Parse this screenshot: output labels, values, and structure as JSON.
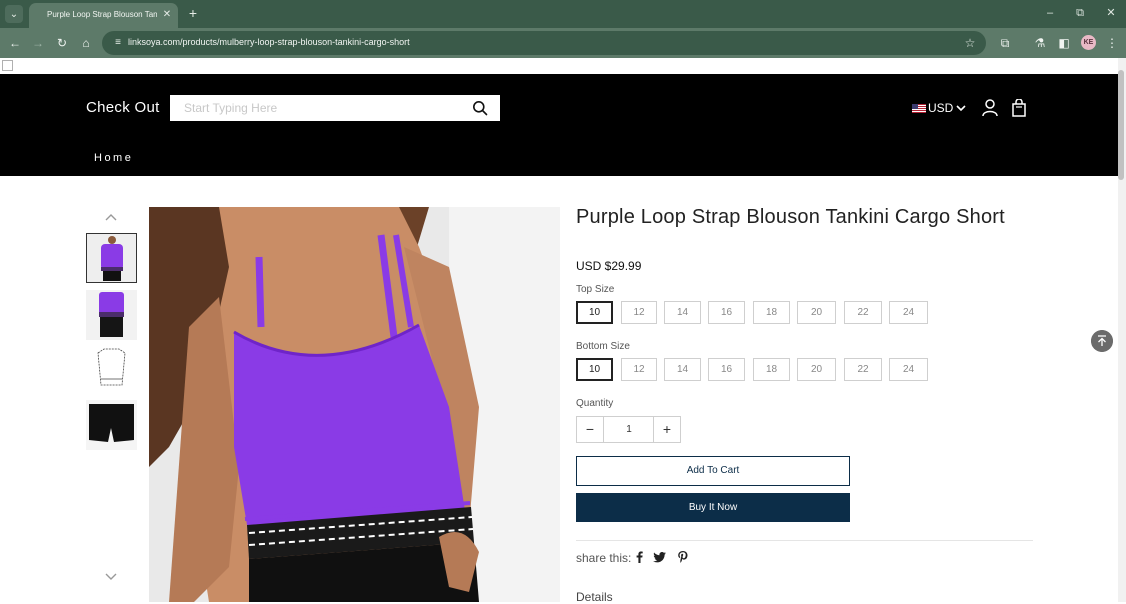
{
  "browser": {
    "tab_title": "Purple Loop Strap Blouson Tankini Cargo Short",
    "url": "linksoya.com/products/mulberry-loop-strap-blouson-tankini-cargo-short",
    "profile_initials": "KE",
    "chrome_color": "#5d7a69",
    "icons": [
      "tab-list-icon",
      "close-icon",
      "new-tab-icon",
      "minimize-icon",
      "restore-icon",
      "close-window-icon",
      "back-icon",
      "forward-icon",
      "reload-icon",
      "home-icon",
      "site-info-icon",
      "star-icon",
      "extensions-icon",
      "labs-icon",
      "sidebar-icon",
      "menu-icon"
    ]
  },
  "header": {
    "logo": "Check Out",
    "search_placeholder": "Start Typing Here",
    "currency": "USD",
    "nav": [
      "Home"
    ]
  },
  "product": {
    "title": "Purple Loop Strap Blouson Tankini Cargo Short",
    "price": "USD $29.99",
    "top_size_label": "Top Size",
    "bottom_size_label": "Bottom Size",
    "sizes": [
      "10",
      "12",
      "14",
      "16",
      "18",
      "20",
      "22",
      "24"
    ],
    "selected_top_size": "10",
    "selected_bottom_size": "10",
    "quantity_label": "Quantity",
    "quantity": "1",
    "add_to_cart": "Add To Cart",
    "buy_now": "Buy It Now",
    "share_label": "share this:",
    "details_label": "Details",
    "accent_color": "#0c2d48",
    "garment_color": "#8a3be6"
  }
}
